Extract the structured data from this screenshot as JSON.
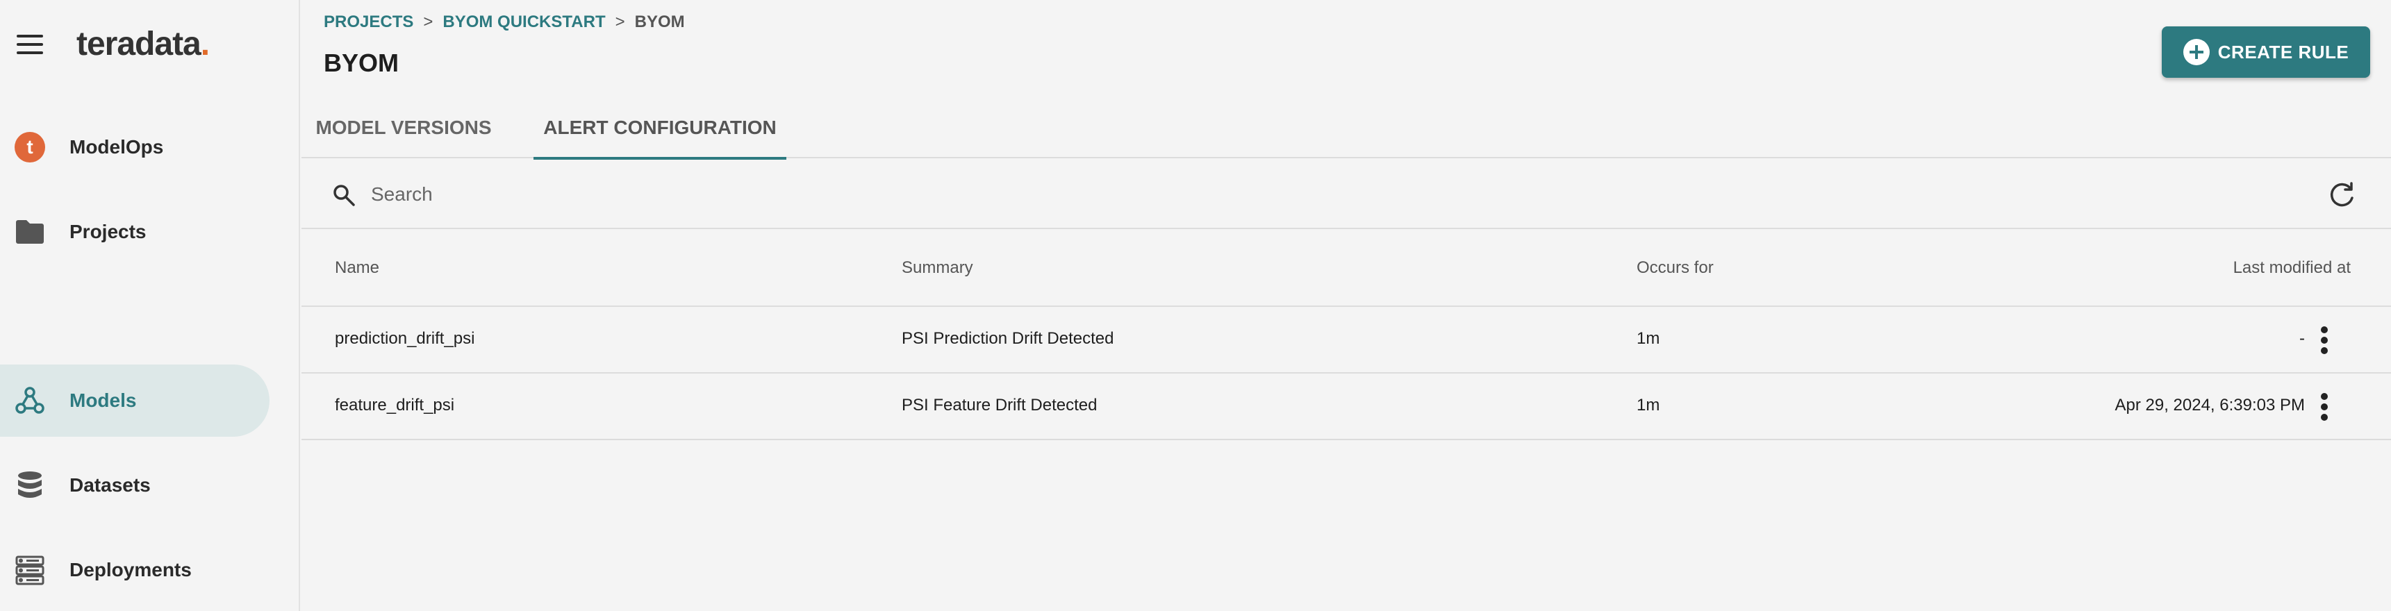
{
  "brand": {
    "logo_text": "teradata",
    "logo_dot": ".",
    "accent_color": "#2d7a80",
    "brand_color": "#e0683a"
  },
  "sidebar": {
    "items": [
      {
        "label": "ModelOps",
        "icon": "teradata-t-icon"
      },
      {
        "label": "Projects",
        "icon": "folder-icon"
      },
      {
        "label": "Models",
        "icon": "webhook-icon",
        "active": true
      },
      {
        "label": "Datasets",
        "icon": "database-icon"
      },
      {
        "label": "Deployments",
        "icon": "server-icon"
      }
    ]
  },
  "header": {
    "breadcrumb": [
      "PROJECTS",
      "BYOM QUICKSTART",
      "BYOM"
    ],
    "breadcrumb_separator": ">",
    "title": "BYOM",
    "create_button_label": "CREATE RULE"
  },
  "tabs": [
    {
      "label": "MODEL VERSIONS",
      "active": false
    },
    {
      "label": "ALERT CONFIGURATION",
      "active": true
    }
  ],
  "search": {
    "placeholder": "Search",
    "value": ""
  },
  "table": {
    "columns": [
      "Name",
      "Summary",
      "Occurs for",
      "Last modified at"
    ],
    "rows": [
      {
        "name": "prediction_drift_psi",
        "summary": "PSI Prediction Drift Detected",
        "occurs_for": "1m",
        "last_modified": "-"
      },
      {
        "name": "feature_drift_psi",
        "summary": "PSI Feature Drift Detected",
        "occurs_for": "1m",
        "last_modified": "Apr 29, 2024, 6:39:03 PM"
      }
    ]
  }
}
